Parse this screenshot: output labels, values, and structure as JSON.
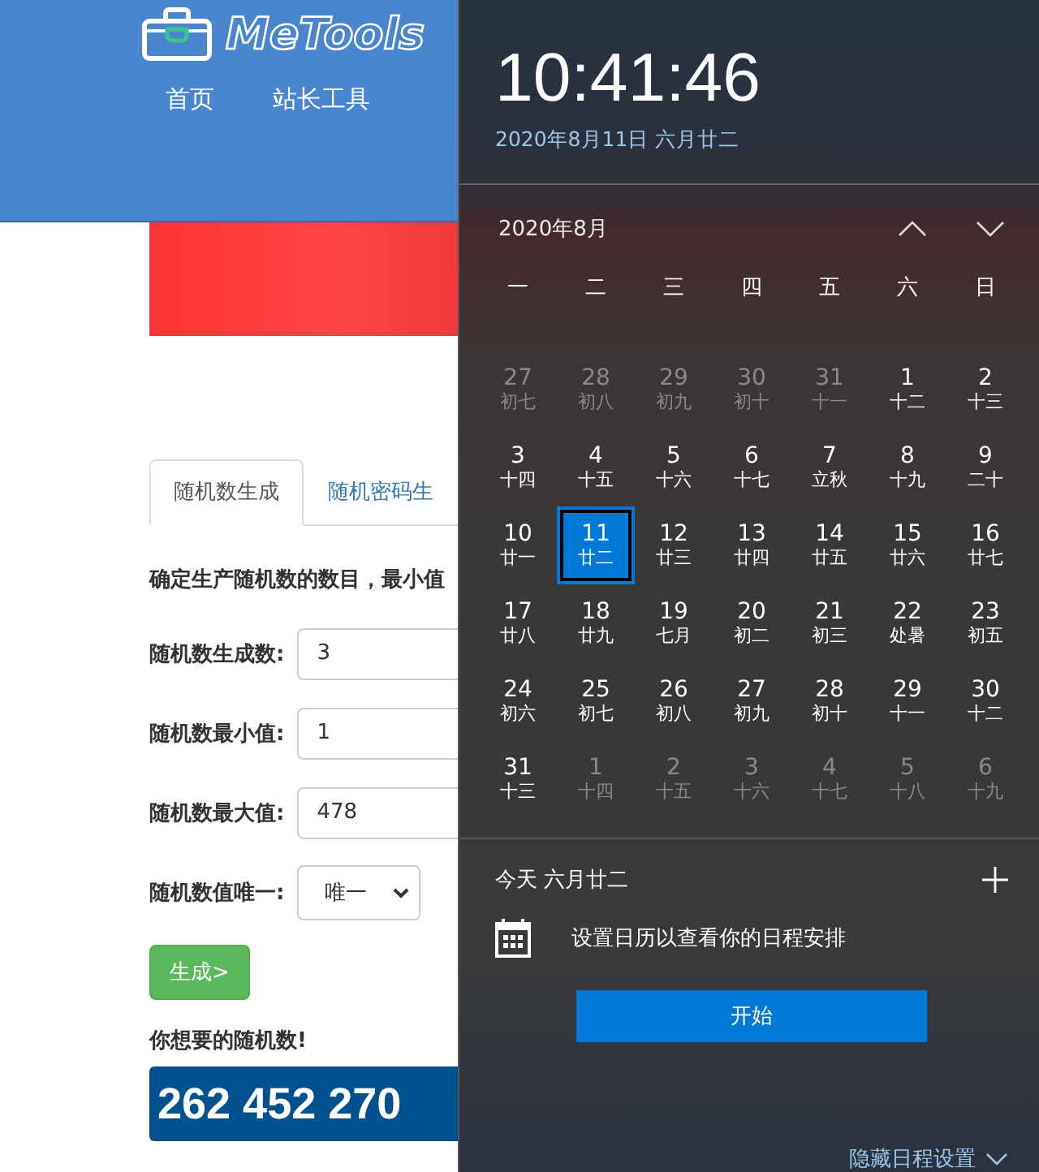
{
  "site": {
    "logo": "MeTools",
    "nav": [
      {
        "label": "首页"
      },
      {
        "label": "站长工具"
      }
    ]
  },
  "tabs": [
    {
      "label": "随机数生成",
      "selected": true
    },
    {
      "label": "随机密码生",
      "selected": false
    }
  ],
  "description": "确定生产随机数的数目，最小值",
  "form": [
    {
      "kind": "input",
      "label": "随机数生成数:",
      "value": "3"
    },
    {
      "kind": "input",
      "label": "随机数最小值:",
      "value": "1"
    },
    {
      "kind": "input",
      "label": "随机数最大值:",
      "value": "478"
    },
    {
      "kind": "select",
      "label": "随机数值唯一:",
      "value": "唯一"
    }
  ],
  "generate_button": "生成>",
  "result_label": "你想要的随机数!",
  "result": "262 452 270",
  "clock": {
    "time": "10:41:46",
    "date": "2020年8月11日 六月廿二"
  },
  "calendar": {
    "month": "2020年8月",
    "weekdays": [
      "一",
      "二",
      "三",
      "四",
      "五",
      "六",
      "日"
    ],
    "days": [
      {
        "day": "27",
        "lunar": "初七",
        "in_month": false,
        "selected": false
      },
      {
        "day": "28",
        "lunar": "初八",
        "in_month": false,
        "selected": false
      },
      {
        "day": "29",
        "lunar": "初九",
        "in_month": false,
        "selected": false
      },
      {
        "day": "30",
        "lunar": "初十",
        "in_month": false,
        "selected": false
      },
      {
        "day": "31",
        "lunar": "十一",
        "in_month": false,
        "selected": false
      },
      {
        "day": "1",
        "lunar": "十二",
        "in_month": true,
        "selected": false
      },
      {
        "day": "2",
        "lunar": "十三",
        "in_month": true,
        "selected": false
      },
      {
        "day": "3",
        "lunar": "十四",
        "in_month": true,
        "selected": false
      },
      {
        "day": "4",
        "lunar": "十五",
        "in_month": true,
        "selected": false
      },
      {
        "day": "5",
        "lunar": "十六",
        "in_month": true,
        "selected": false
      },
      {
        "day": "6",
        "lunar": "十七",
        "in_month": true,
        "selected": false
      },
      {
        "day": "7",
        "lunar": "立秋",
        "in_month": true,
        "selected": false
      },
      {
        "day": "8",
        "lunar": "十九",
        "in_month": true,
        "selected": false
      },
      {
        "day": "9",
        "lunar": "二十",
        "in_month": true,
        "selected": false
      },
      {
        "day": "10",
        "lunar": "廿一",
        "in_month": true,
        "selected": false
      },
      {
        "day": "11",
        "lunar": "廿二",
        "in_month": true,
        "selected": true
      },
      {
        "day": "12",
        "lunar": "廿三",
        "in_month": true,
        "selected": false
      },
      {
        "day": "13",
        "lunar": "廿四",
        "in_month": true,
        "selected": false
      },
      {
        "day": "14",
        "lunar": "廿五",
        "in_month": true,
        "selected": false
      },
      {
        "day": "15",
        "lunar": "廿六",
        "in_month": true,
        "selected": false
      },
      {
        "day": "16",
        "lunar": "廿七",
        "in_month": true,
        "selected": false
      },
      {
        "day": "17",
        "lunar": "廿八",
        "in_month": true,
        "selected": false
      },
      {
        "day": "18",
        "lunar": "廿九",
        "in_month": true,
        "selected": false
      },
      {
        "day": "19",
        "lunar": "七月",
        "in_month": true,
        "selected": false
      },
      {
        "day": "20",
        "lunar": "初二",
        "in_month": true,
        "selected": false
      },
      {
        "day": "21",
        "lunar": "初三",
        "in_month": true,
        "selected": false
      },
      {
        "day": "22",
        "lunar": "处暑",
        "in_month": true,
        "selected": false
      },
      {
        "day": "23",
        "lunar": "初五",
        "in_month": true,
        "selected": false
      },
      {
        "day": "24",
        "lunar": "初六",
        "in_month": true,
        "selected": false
      },
      {
        "day": "25",
        "lunar": "初七",
        "in_month": true,
        "selected": false
      },
      {
        "day": "26",
        "lunar": "初八",
        "in_month": true,
        "selected": false
      },
      {
        "day": "27",
        "lunar": "初九",
        "in_month": true,
        "selected": false
      },
      {
        "day": "28",
        "lunar": "初十",
        "in_month": true,
        "selected": false
      },
      {
        "day": "29",
        "lunar": "十一",
        "in_month": true,
        "selected": false
      },
      {
        "day": "30",
        "lunar": "十二",
        "in_month": true,
        "selected": false
      },
      {
        "day": "31",
        "lunar": "十三",
        "in_month": true,
        "selected": false
      },
      {
        "day": "1",
        "lunar": "十四",
        "in_month": false,
        "selected": false
      },
      {
        "day": "2",
        "lunar": "十五",
        "in_month": false,
        "selected": false
      },
      {
        "day": "3",
        "lunar": "十六",
        "in_month": false,
        "selected": false
      },
      {
        "day": "4",
        "lunar": "十七",
        "in_month": false,
        "selected": false
      },
      {
        "day": "5",
        "lunar": "十八",
        "in_month": false,
        "selected": false
      },
      {
        "day": "6",
        "lunar": "十九",
        "in_month": false,
        "selected": false
      }
    ]
  },
  "agenda": {
    "today": "今天 六月廿二",
    "message": "设置日历以查看你的日程安排",
    "start_button": "开始",
    "hide_link": "隐藏日程设置"
  }
}
